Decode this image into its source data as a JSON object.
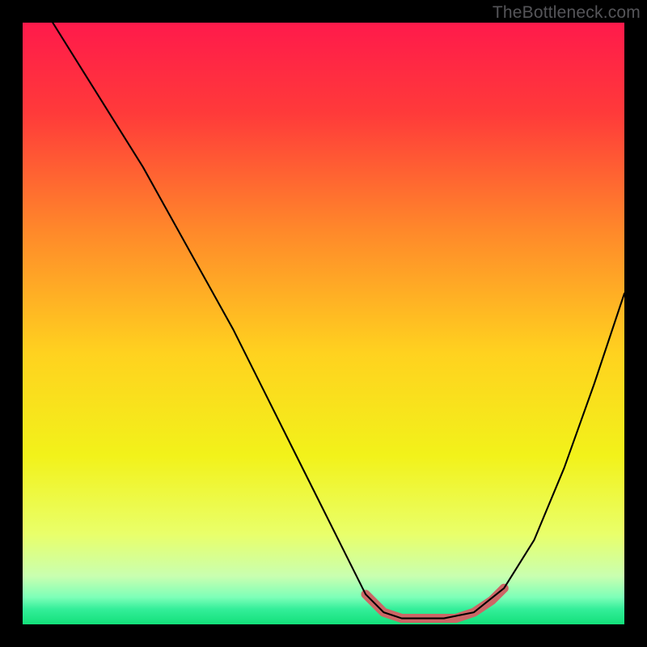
{
  "watermark": "TheBottleneck.com",
  "chart_data": {
    "type": "line",
    "title": "",
    "xlabel": "",
    "ylabel": "",
    "xlim": [
      0,
      100
    ],
    "ylim": [
      0,
      100
    ],
    "series": [
      {
        "name": "main-curve",
        "color": "#000000",
        "x": [
          5,
          10,
          15,
          20,
          25,
          30,
          35,
          40,
          45,
          50,
          55,
          57,
          60,
          63,
          65,
          70,
          75,
          80,
          85,
          90,
          95,
          100
        ],
        "y": [
          100,
          92,
          84,
          76,
          67,
          58,
          49,
          39,
          29,
          19,
          9,
          5,
          2,
          1,
          1,
          1,
          2,
          6,
          14,
          26,
          40,
          55
        ]
      },
      {
        "name": "bottom-band",
        "color": "#cc6666",
        "x": [
          57,
          60,
          63,
          66,
          69,
          72,
          75,
          78,
          80
        ],
        "y": [
          5,
          2,
          1,
          1,
          1,
          1,
          2,
          4,
          6
        ]
      }
    ],
    "gradient_stops": [
      {
        "offset": 0.0,
        "color": "#ff1a4b"
      },
      {
        "offset": 0.15,
        "color": "#ff3a3a"
      },
      {
        "offset": 0.35,
        "color": "#ff8a2a"
      },
      {
        "offset": 0.55,
        "color": "#ffd21f"
      },
      {
        "offset": 0.72,
        "color": "#f2f21a"
      },
      {
        "offset": 0.85,
        "color": "#e9ff6a"
      },
      {
        "offset": 0.92,
        "color": "#c9ffb0"
      },
      {
        "offset": 0.955,
        "color": "#7dffb8"
      },
      {
        "offset": 0.975,
        "color": "#33ee99"
      },
      {
        "offset": 1.0,
        "color": "#13e07a"
      }
    ]
  }
}
